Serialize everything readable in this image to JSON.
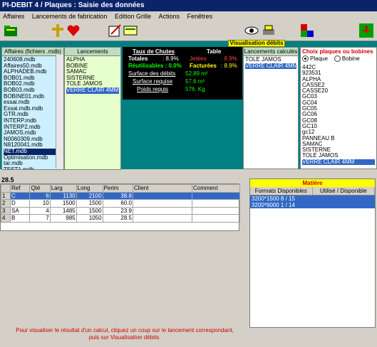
{
  "window": {
    "title": "PI-DEBIT 4 / Plaques : Saisie des données"
  },
  "menu": [
    "Affaires",
    "Lancements de fabrication",
    "Edition Grille",
    "Actions",
    "Fenêtres"
  ],
  "toolbar": {
    "icons": [
      "folder-icon",
      "cross-icon",
      "heart-icon",
      "edit-icon",
      "document-icon",
      "eye-icon",
      "printer-icon",
      "color-blocks-icon",
      "exit-icon"
    ]
  },
  "affaires": {
    "header": "Affaires (fichiers .mdb)",
    "items": [
      "240608.mdb",
      "Affaires50.mdb",
      "ALPHADEB.mdb",
      "BOB01.mdb",
      "BOB02.mdb",
      "BOB03.mdb",
      "BOBINE01.mdb",
      "essai.mdb",
      "Essai.mdb.mdb",
      "GTR.mdb",
      "INTERP.mdb",
      "INTERP2.mdb",
      "JAMOS.mdb",
      "N0060309.mdb",
      "N8120041.mdb",
      "NET.mdb",
      "Optimisation.mdb",
      "tar.mdb",
      "TEST1.mdb"
    ],
    "selected_index": 15
  },
  "lancements": {
    "header": "Lancements",
    "items": [
      "ALPHA",
      "BOBINE",
      "SAMAC",
      "SISTERNE",
      "TOLE JAMOS",
      "VERRE CLAIR 4MM"
    ],
    "selected_index": 5
  },
  "stats": {
    "taux_label": "Taux de Chutes",
    "table_label": "Table",
    "totales_label": "Totales",
    "totales_value": ": 8.9%",
    "jetees_label": "Jetées",
    "jetees_value": ": 8.9%",
    "reutilisables_label": "Réutilisables : 0.0%",
    "facturees_label": "Facturées",
    "facturees_value": ": 8.9%",
    "surface_debits_label": "Surface des débits",
    "surface_debits_value": "52.89 m²",
    "surface_requise_label": "Surface requise",
    "surface_requise_value": "57.6 m²",
    "poids_label": "Poids requis",
    "poids_value": "576. Kg"
  },
  "visualisation": {
    "label": "Visualisation débits"
  },
  "calcules": {
    "header": "Lancements calculés",
    "items": [
      "TOLE JAMOS",
      "VERRE CLAIR 4MM"
    ],
    "selected_index": 1
  },
  "choix": {
    "title": "Choix plaques ou bobines",
    "radio_plaque": "Plaque",
    "radio_bobine": "Bobine",
    "items": [
      "442C",
      "923531",
      "ALPHA",
      "CASSE2",
      "CASSE20",
      "GC03",
      "GC04",
      "GC05",
      "GC06",
      "GC08",
      "GC10",
      "gc12",
      "PANNEAU B",
      "SAMAC",
      "SISTERNE",
      "TOLE JAMOS",
      "VERRE CLAIR 4MM"
    ],
    "selected_index": 16
  },
  "grid": {
    "quantity_display": "28.5",
    "columns": [
      "",
      "Ref",
      "Qté",
      "Larg",
      "Long",
      "Perim",
      "Client",
      "Comment"
    ],
    "rows": [
      {
        "num": "1",
        "ref": "C",
        "qte": "6",
        "larg": "1130",
        "long": "2100",
        "perim": "38.8",
        "client": "",
        "comment": ""
      },
      {
        "num": "2",
        "ref": "D",
        "qte": "10",
        "larg": "1500",
        "long": "1500",
        "perim": "60.0",
        "client": "",
        "comment": ""
      },
      {
        "num": "3",
        "ref": "SA",
        "qte": "4",
        "larg": "1485",
        "long": "1500",
        "perim": "23.9",
        "client": "",
        "comment": ""
      },
      {
        "num": "4",
        "ref": "B",
        "qte": "7",
        "larg": "985",
        "long": "1050",
        "perim": "28.5",
        "client": "",
        "comment": ""
      }
    ],
    "selected_index": 0
  },
  "matiere": {
    "title": "Matière",
    "col1": "Formats Disponibles",
    "col2": "Utilisé / Disponible",
    "rows": [
      "3200*1500  8 / 15",
      "3200*6000  1 / 14"
    ],
    "selected_index": 0
  },
  "footer": {
    "message1": "Pour visualiser le résultat d'un calcul, cliquez un coup sur le lancement correspondant,",
    "message2": "puis sur Visualisation débits."
  },
  "colors": {
    "teal": "#008080",
    "title_blue": "#0a246a",
    "selection": "#3168c5",
    "alert_red": "#d00000",
    "highlight_yellow": "#ffff00"
  }
}
